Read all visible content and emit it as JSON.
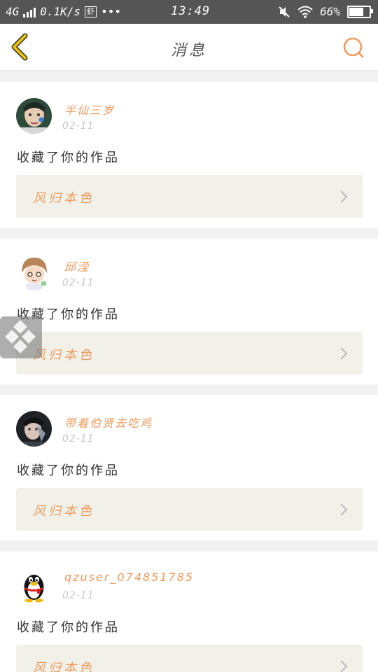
{
  "status_bar": {
    "network": "4G",
    "speed": "0.1K/s",
    "app_badge": "虾",
    "more": "•••",
    "time": "13:49",
    "battery": "66%"
  },
  "header": {
    "title": "消息"
  },
  "messages": [
    {
      "username": "半仙三岁",
      "date": "02-11",
      "action": "收藏了你的作品",
      "work_title": "风归本色"
    },
    {
      "username": "邱滢",
      "date": "02-11",
      "action": "收藏了你的作品",
      "work_title": "风归本色"
    },
    {
      "username": "带着伯贤去吃鸡",
      "date": "02-11",
      "action": "收藏了你的作品",
      "work_title": "风归本色"
    },
    {
      "username": "qzuser_074851785",
      "date": "02-11",
      "action": "收藏了你的作品",
      "work_title": "风归本色"
    }
  ],
  "colors": {
    "accent": "#ef9a5c",
    "back_icon": "#e9c200",
    "status_bar": "#555555"
  }
}
